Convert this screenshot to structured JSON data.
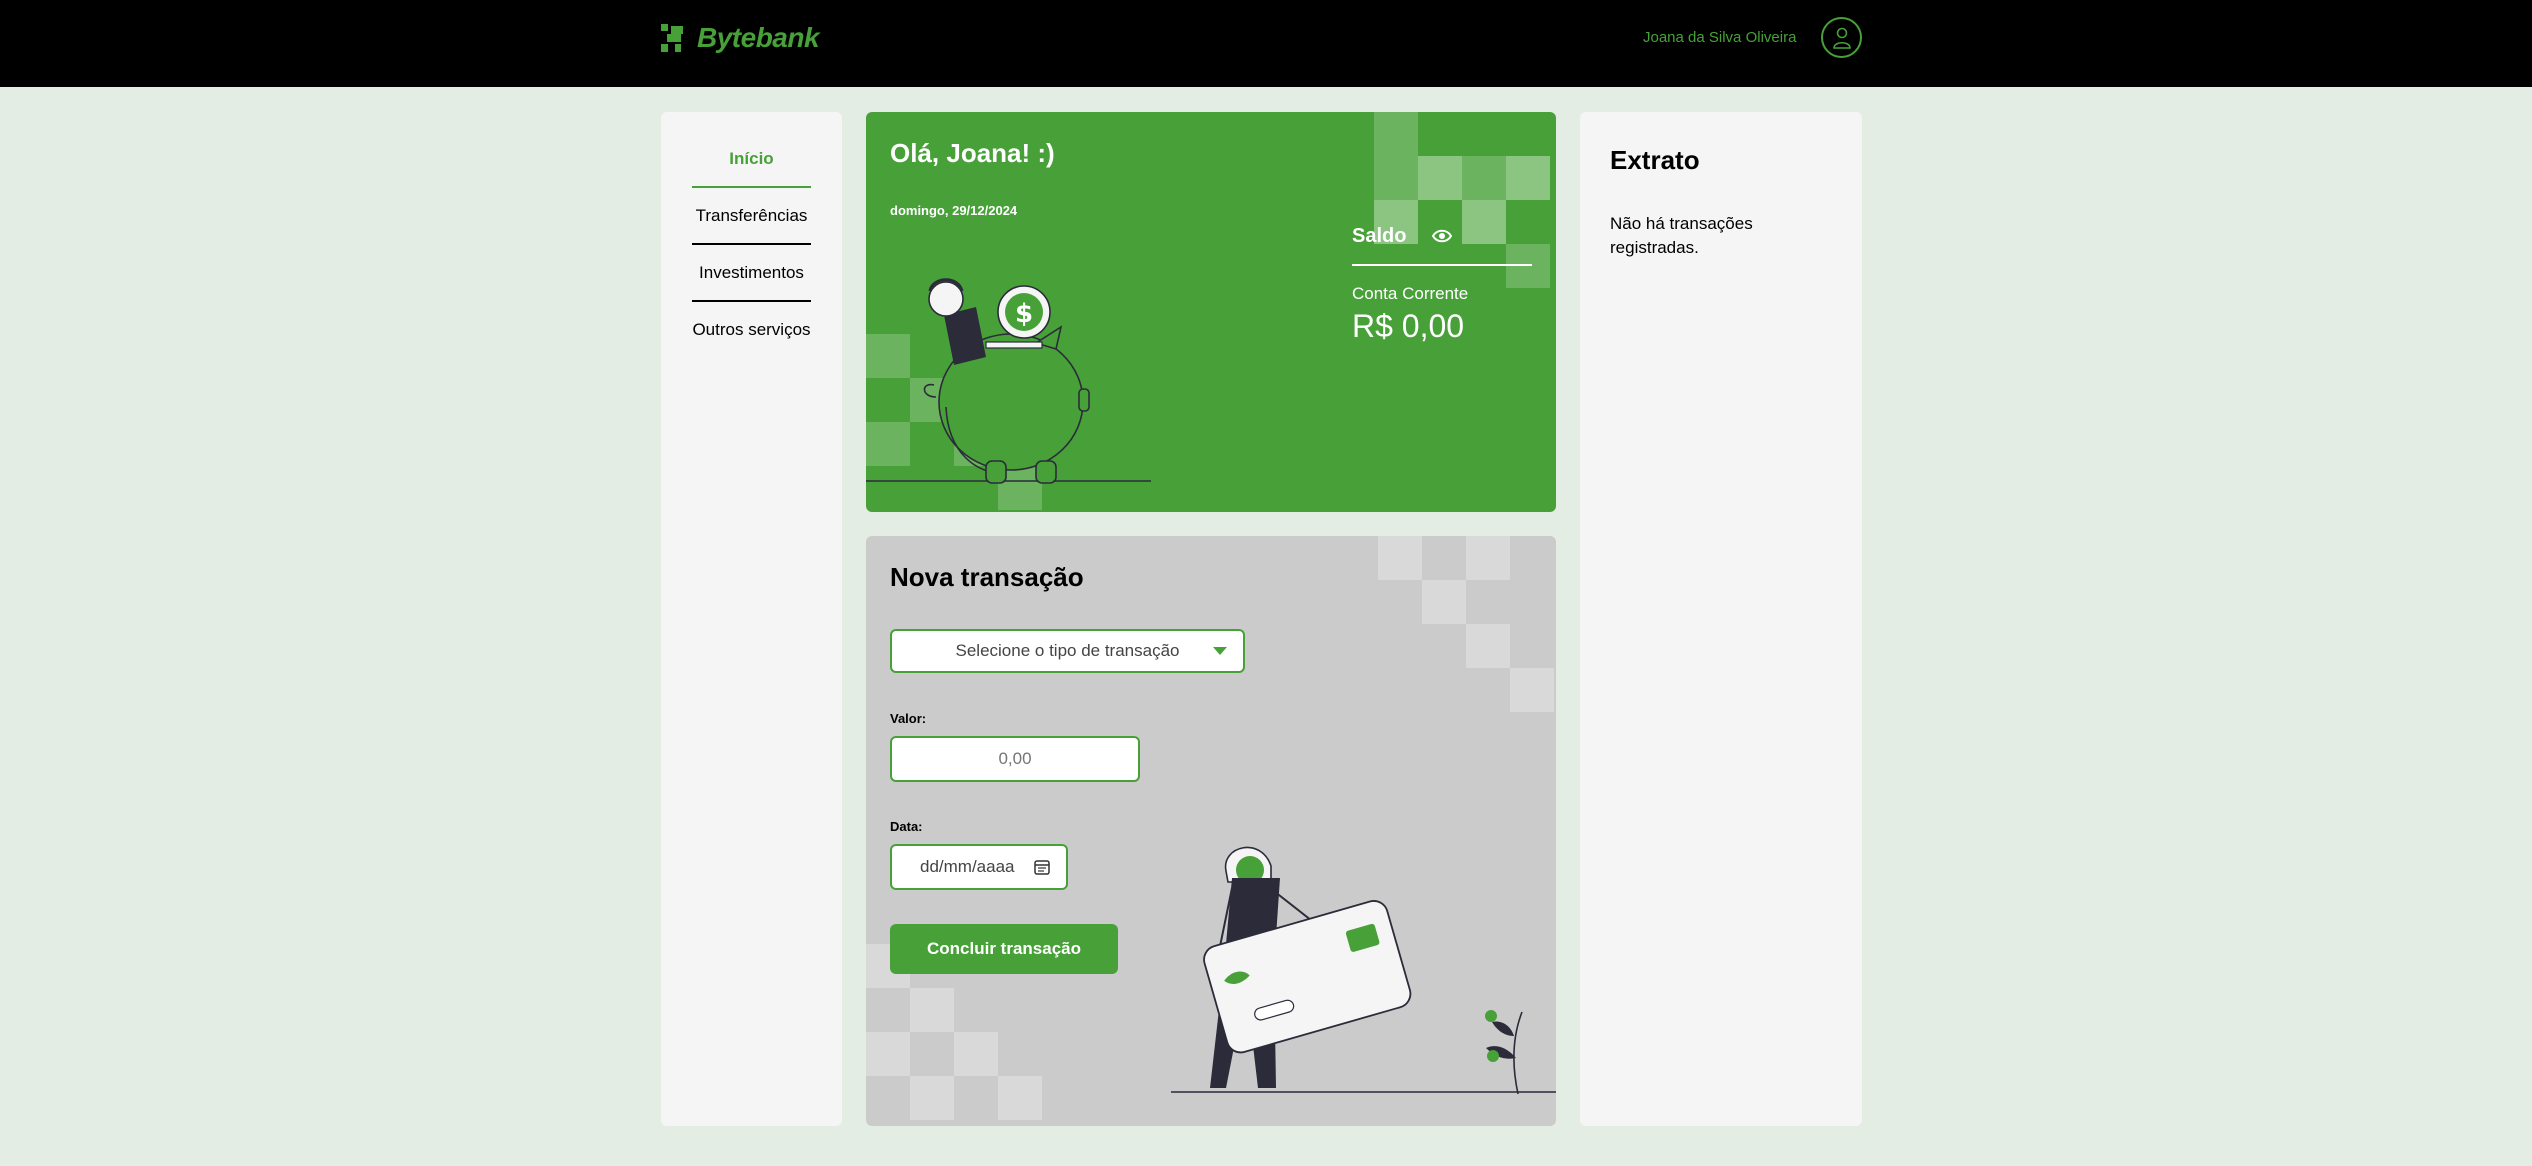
{
  "colors": {
    "brand": "#47a138",
    "header_bg": "#000000",
    "page_bg": "#e4ede3",
    "card_gray": "#cbcbcb",
    "panel_bg": "#f5f5f5"
  },
  "header": {
    "logo_text": "Bytebank",
    "logo_icon": "bytebank-logo-icon",
    "user_name": "Joana da Silva Oliveira",
    "avatar_icon": "user-icon"
  },
  "sidebar": {
    "items": [
      {
        "label": "Início",
        "active": true
      },
      {
        "label": "Transferências",
        "active": false
      },
      {
        "label": "Investimentos",
        "active": false
      },
      {
        "label": "Outros serviços",
        "active": false
      }
    ]
  },
  "balance": {
    "greeting": "Olá, Joana! :)",
    "date": "domingo, 29/12/2024",
    "label": "Saldo",
    "visibility_icon": "eye-icon",
    "account_type": "Conta Corrente",
    "value": "R$ 0,00"
  },
  "transaction": {
    "title": "Nova transação",
    "type_placeholder": "Selecione o tipo de transação",
    "amount_label": "Valor:",
    "amount_placeholder": "0,00",
    "date_label": "Data:",
    "date_placeholder": "dd/mm/aaaa",
    "calendar_icon": "calendar-icon",
    "submit_label": "Concluir transação"
  },
  "statement": {
    "title": "Extrato",
    "empty_message": "Não há transações registradas."
  }
}
